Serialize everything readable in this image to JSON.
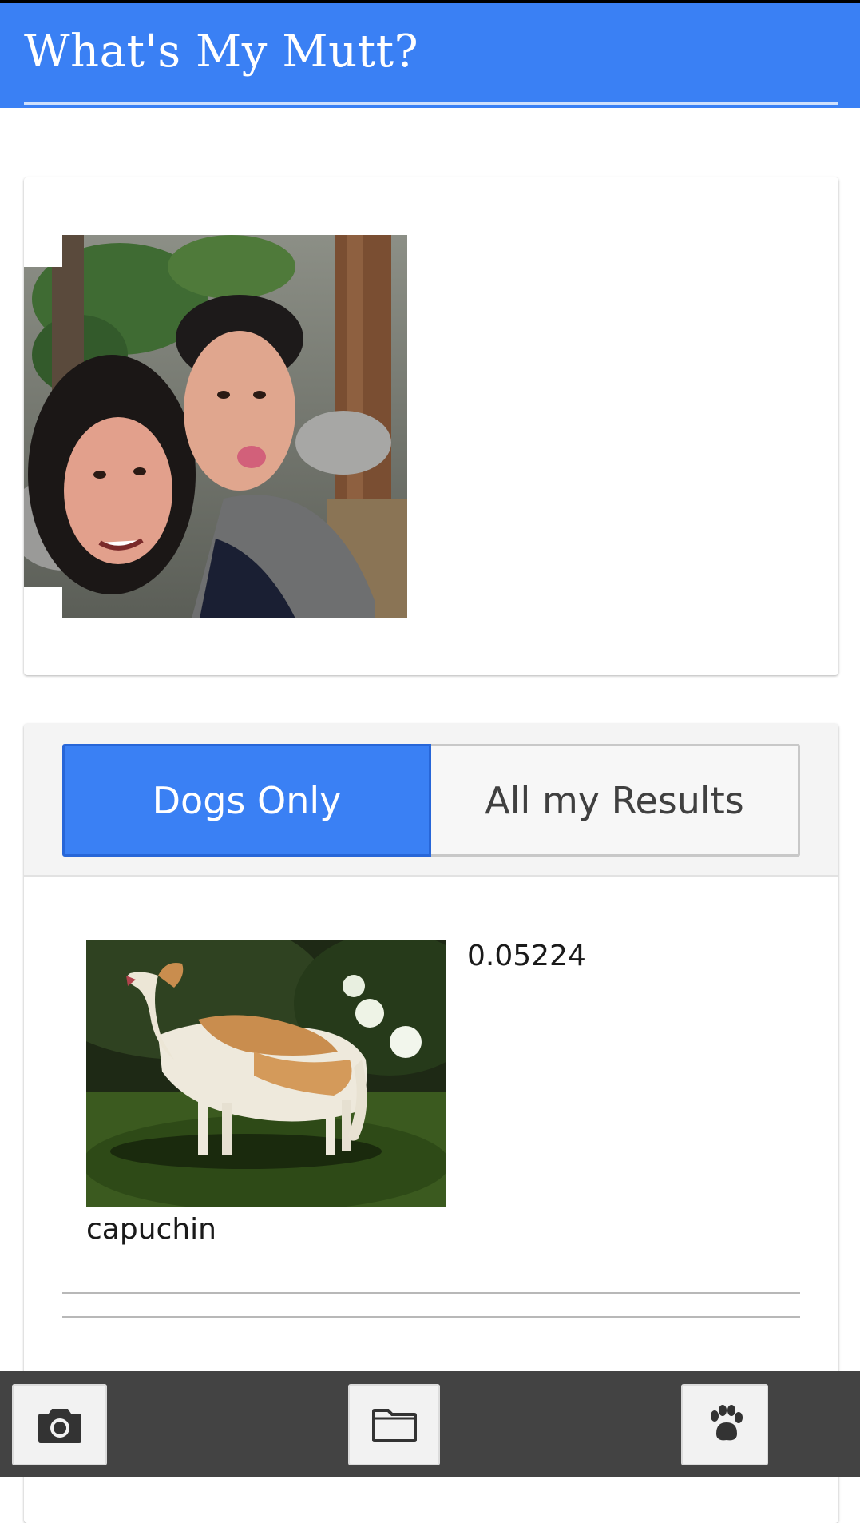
{
  "app_bar": {
    "title": "What's My Mutt?",
    "color": "#3a80f4"
  },
  "photo_card": {
    "image": "uploaded-selfie-photo"
  },
  "results": {
    "tabs": [
      {
        "label": "Dogs Only",
        "active": true
      },
      {
        "label": "All my Results",
        "active": false
      }
    ],
    "items": [
      {
        "breed": "capuchin",
        "score": "0.05224",
        "image": "borzoi-dog-photo"
      }
    ]
  },
  "bottom_bar": {
    "buttons": [
      {
        "icon": "camera-icon"
      },
      {
        "icon": "folder-icon"
      },
      {
        "icon": "paw-icon"
      }
    ]
  },
  "colors": {
    "accent": "#3a80f4",
    "bottom_bar": "#434343"
  }
}
